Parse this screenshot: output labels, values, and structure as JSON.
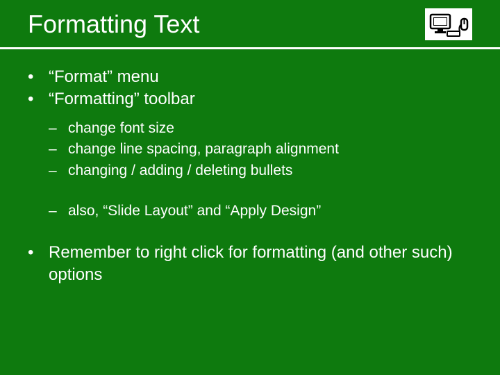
{
  "title": "Formatting Text",
  "bullets": {
    "b1": "“Format” menu",
    "b2": "“Formatting” toolbar",
    "b3": "Remember to right click for formatting (and other such) options"
  },
  "sub": {
    "s1": "change font size",
    "s2": "change line spacing, paragraph alignment",
    "s3": "changing / adding / deleting bullets",
    "s4": "also, “Slide Layout” and “Apply Design”"
  },
  "marks": {
    "bullet": "•",
    "dash": "–"
  }
}
